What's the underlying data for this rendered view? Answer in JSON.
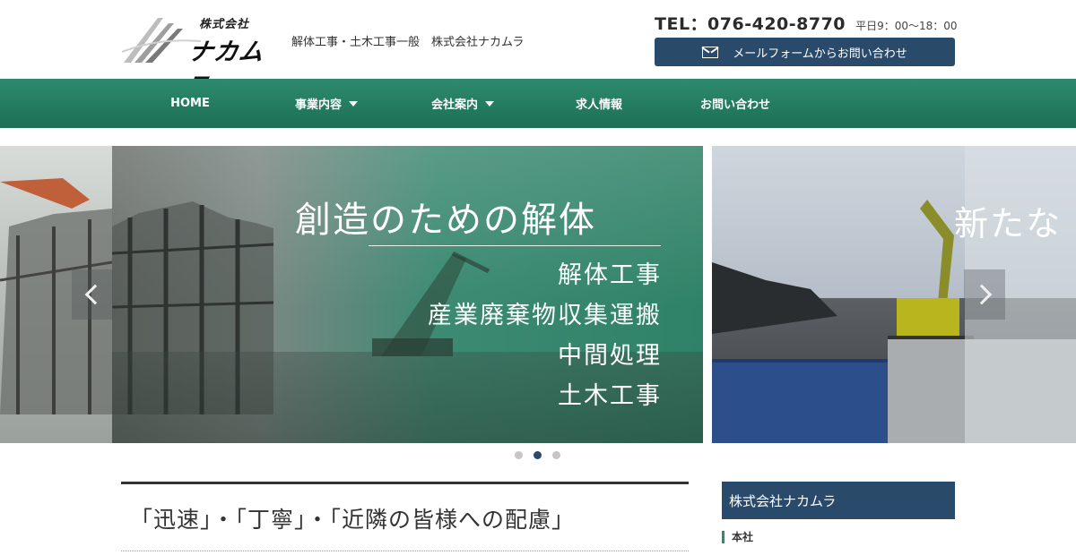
{
  "header": {
    "logo_small": "株式会社",
    "logo_big": "ナカムラ",
    "tagline": "解体工事・土木工事一般　株式会社ナカムラ",
    "tel_label": "TEL：076-420-8770",
    "tel_hours": "平日9：00～18：00",
    "mail_button_label": "メールフォームからお問い合わせ"
  },
  "nav": {
    "items": [
      {
        "label": "HOME"
      },
      {
        "label": "事業内容"
      },
      {
        "label": "会社案内"
      },
      {
        "label": "求人情報"
      },
      {
        "label": "お問い合わせ"
      }
    ]
  },
  "slider": {
    "main_title": "創造のための解体",
    "main_items": [
      "解体工事",
      "産業廃棄物収集運搬",
      "中間処理",
      "土木工事"
    ],
    "next_title_partial": "新たな",
    "active_dot": 2,
    "dot_count": 3
  },
  "content": {
    "heading": "「迅速」・「丁寧」・「近隣の皆様への配慮」",
    "side_title": "株式会社ナカムラ",
    "side_sub": "本社"
  },
  "colors": {
    "nav_green": "#2e8b6e",
    "accent_navy": "#2a4a6b"
  }
}
